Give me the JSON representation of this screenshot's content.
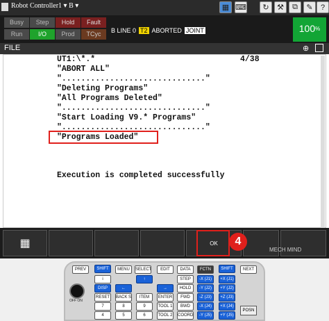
{
  "window": {
    "title": "Robot Controller1 ▾ B ▾"
  },
  "status": {
    "busy": "Busy",
    "step": "Step",
    "hold": "Hold",
    "fault": "Fault",
    "run": "Run",
    "io": "I/O",
    "prod": "Prod",
    "tcyc": "TCyc",
    "line_info": "B  LINE 0",
    "mode": "T2",
    "state": "ABORTED",
    "coord": "JOINT",
    "override": "100",
    "override_unit": "%"
  },
  "screen": {
    "name": "FILE"
  },
  "content": {
    "lines": [
      "UT1:\\*.*",
      "\"ABORT ALL\"",
      "\"..............................\"",
      "\"Deleting Programs\"",
      "\"All Programs Deleted\"",
      "\"..............................\"",
      "\"Start Loading V9.* Programs\"",
      "\"..............................\"",
      "\"Programs Loaded\""
    ],
    "page_indicator": "4/38",
    "message": "Execution is completed successfully"
  },
  "softkeys": {
    "ok": "OK",
    "menu_icon": "grid-icon"
  },
  "annotation": {
    "step_number": "4"
  },
  "keypad": {
    "row1": [
      "PREV",
      "SHIFT",
      "MENU",
      "SELECT",
      "EDIT",
      "DATA",
      "FCTN",
      "SHIFT",
      "NEXT"
    ],
    "row2": [
      "i",
      "↑",
      "STEP",
      "-X (J1)",
      "+X (J1)"
    ],
    "row3": [
      "DISP",
      "←",
      "→",
      "HOLD",
      "-Y (J2)",
      "+Y (J2)"
    ],
    "row4": [
      "RESET",
      "BACK SPACE",
      "ITEM",
      "ENTER",
      "FWD",
      "-Z (J3)",
      "+Z (J3)"
    ],
    "row5": [
      "7",
      "8",
      "9",
      "TOOL 1",
      "BWD",
      "-X (J4)",
      "+X (J4)"
    ],
    "row6": [
      "4",
      "5",
      "6",
      "TOOL 2",
      "COORD",
      "-Y (J5)",
      "+Y (J5)"
    ],
    "power_label": "OFF ON",
    "posn": "POSN"
  },
  "watermark": "MECH MIND",
  "colors": {
    "highlight": "#e0201c",
    "active_green": "#1fa32c",
    "t2_yellow": "#f2d400"
  }
}
